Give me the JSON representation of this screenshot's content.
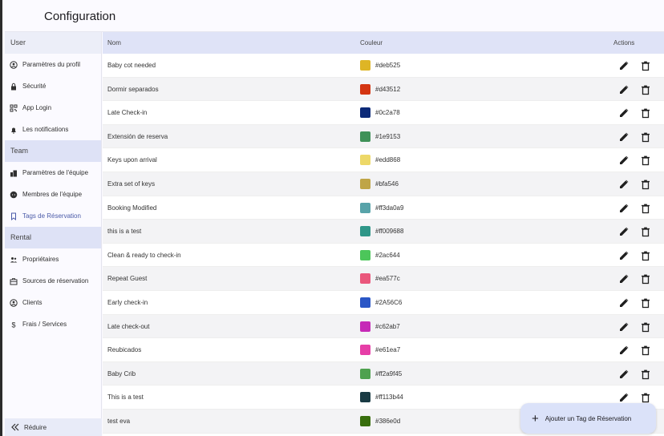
{
  "header": {
    "title": "Configuration"
  },
  "sidebar": {
    "sections": [
      {
        "label": "User",
        "items": [
          {
            "label": "Paramètres du profil",
            "icon": "profile-icon"
          },
          {
            "label": "Sécurité",
            "icon": "lock-icon"
          },
          {
            "label": "App Login",
            "icon": "qr-icon"
          },
          {
            "label": "Les notifications",
            "icon": "bell-icon"
          }
        ]
      },
      {
        "label": "Team",
        "items": [
          {
            "label": "Paramètres de l'équipe",
            "icon": "building-icon"
          },
          {
            "label": "Membres de l'équipe",
            "icon": "face-icon"
          },
          {
            "label": "Tags de Réservation",
            "icon": "bookmark-icon",
            "active": true
          }
        ]
      },
      {
        "label": "Rental",
        "items": [
          {
            "label": "Propriétaires",
            "icon": "people-icon"
          },
          {
            "label": "Sources de réservation",
            "icon": "suitcase-icon"
          },
          {
            "label": "Clients",
            "icon": "person-circle-icon"
          },
          {
            "label": "Frais / Services",
            "icon": "dollar-icon"
          }
        ]
      }
    ],
    "collapse_label": "Réduire"
  },
  "table": {
    "headers": {
      "name": "Nom",
      "color": "Couleur",
      "actions": "Actions"
    },
    "rows": [
      {
        "name": "Baby cot needed",
        "hex": "#deb525",
        "color": "#deb525"
      },
      {
        "name": "Dormir separados",
        "hex": "#d43512",
        "color": "#d43512"
      },
      {
        "name": "Late Check-in",
        "hex": "#0c2a78",
        "color": "#0c2a78"
      },
      {
        "name": "Extensión de reserva",
        "hex": "#1e9153",
        "color": "#3f9158"
      },
      {
        "name": "Keys upon arrival",
        "hex": "#edd868",
        "color": "#edd868"
      },
      {
        "name": "Extra set of keys",
        "hex": "#bfa546",
        "color": "#bfa546"
      },
      {
        "name": "Booking Modified",
        "hex": "#ff3da0a9",
        "color": "#58a3a9"
      },
      {
        "name": "this is a test",
        "hex": "#ff009688",
        "color": "#2f9688"
      },
      {
        "name": "Clean & ready to check-in",
        "hex": "#2ac644",
        "color": "#4cc65a"
      },
      {
        "name": "Repeat Guest",
        "hex": "#ea577c",
        "color": "#ea577c"
      },
      {
        "name": "Early check-in",
        "hex": "#2A56C6",
        "color": "#2a56c6"
      },
      {
        "name": "Late check-out",
        "hex": "#c62ab7",
        "color": "#c62ab7"
      },
      {
        "name": "Reubicados",
        "hex": "#e61ea7",
        "color": "#e63ea7"
      },
      {
        "name": "Baby Crib",
        "hex": "#ff2a9f45",
        "color": "#4fa14f"
      },
      {
        "name": "This is a test",
        "hex": "#ff113b44",
        "color": "#1a3b44"
      },
      {
        "name": "test eva",
        "hex": "#386e0d",
        "color": "#386e0d"
      }
    ]
  },
  "fab": {
    "label": "Ajouter un Tag de Réservation"
  }
}
